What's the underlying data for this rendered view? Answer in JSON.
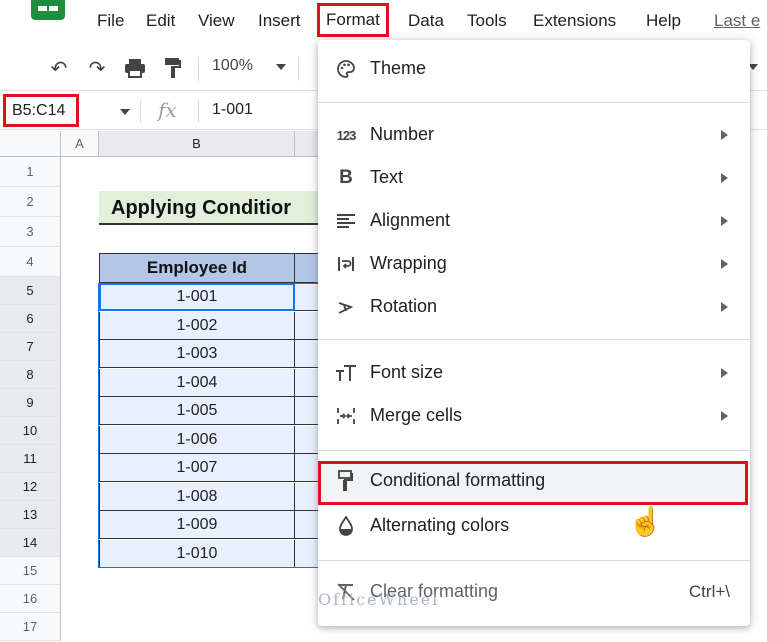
{
  "menubar": {
    "items": [
      "File",
      "Edit",
      "View",
      "Insert",
      "Format",
      "Data",
      "Tools",
      "Extensions",
      "Help"
    ],
    "last_edit": "Last e"
  },
  "toolbar": {
    "icons": [
      "undo-icon",
      "redo-icon",
      "print-icon",
      "paint-format-icon"
    ],
    "zoom": "100%"
  },
  "formula_bar": {
    "name_box": "B5:C14",
    "fx": "fx",
    "value": "1-001"
  },
  "grid": {
    "columns": [
      "A",
      "B"
    ],
    "rows": [
      "1",
      "2",
      "3",
      "4",
      "5",
      "6",
      "7",
      "8",
      "9",
      "10",
      "11",
      "12",
      "13",
      "14",
      "15",
      "16",
      "17"
    ],
    "title": "Applying Conditior",
    "table_header": "Employee Id",
    "employee_ids": [
      "1-001",
      "1-002",
      "1-003",
      "1-004",
      "1-005",
      "1-006",
      "1-007",
      "1-008",
      "1-009",
      "1-010"
    ]
  },
  "format_menu": {
    "items": [
      {
        "label": "Theme",
        "icon": "palette-icon"
      },
      {
        "label": "Number",
        "icon": "number-123-icon"
      },
      {
        "label": "Text",
        "icon": "bold-b-icon"
      },
      {
        "label": "Alignment",
        "icon": "align-left-icon"
      },
      {
        "label": "Wrapping",
        "icon": "text-wrap-icon"
      },
      {
        "label": "Rotation",
        "icon": "text-rotation-icon"
      },
      {
        "label": "Font size",
        "icon": "font-size-icon"
      },
      {
        "label": "Merge cells",
        "icon": "merge-cells-icon"
      },
      {
        "label": "Conditional formatting",
        "icon": "paint-roller-icon"
      },
      {
        "label": "Alternating colors",
        "icon": "drop-icon"
      },
      {
        "label": "Clear formatting",
        "icon": "clear-format-icon",
        "shortcut": "Ctrl+\\"
      }
    ]
  },
  "watermark": "OfficeWheel",
  "colors": {
    "highlight_border": "#e0111b",
    "selection_blue": "#1a73e8",
    "header_fill": "#b4c6e7",
    "title_fill": "#e2efda"
  }
}
